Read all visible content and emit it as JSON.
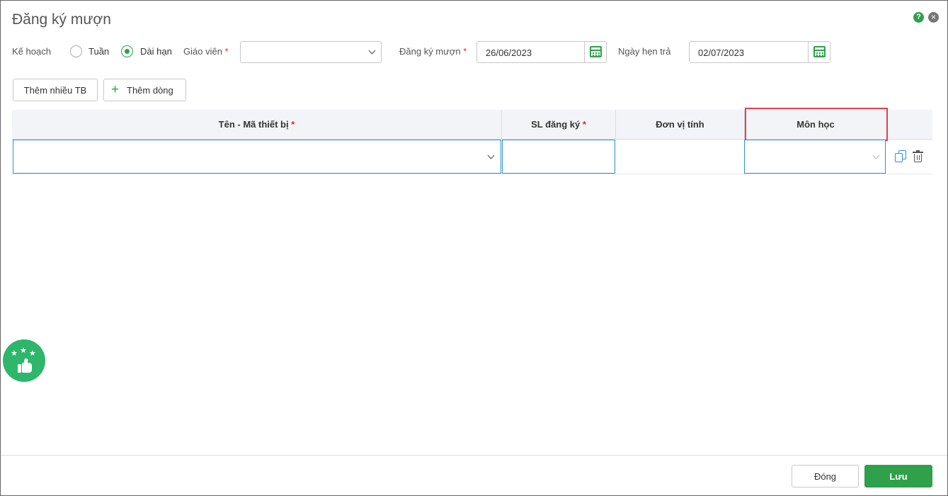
{
  "dialog": {
    "title": "Đăng ký mượn"
  },
  "form": {
    "plan_label": "Kế hoạch",
    "radio_week": "Tuần",
    "radio_long": "Dài hạn",
    "selected_plan": "Dài hạn",
    "teacher_label": "Giáo viên",
    "teacher_value": "",
    "borrow_date_label": "Đăng ký mượn",
    "borrow_date": "26/06/2023",
    "return_date_label": "Ngày hẹn trả",
    "return_date": "02/07/2023",
    "required_mark": "*"
  },
  "toolbar": {
    "add_many_label": "Thêm nhiều TB",
    "add_row_label": "Thêm dòng"
  },
  "grid": {
    "columns": [
      {
        "label": "Tên - Mã thiết bị",
        "required": true
      },
      {
        "label": "SL đăng ký",
        "required": true
      },
      {
        "label": "Đơn vị tính",
        "required": false
      },
      {
        "label": "Môn học",
        "required": false
      }
    ],
    "rows": [
      {
        "device": "",
        "quantity": "",
        "unit": "",
        "subject": ""
      }
    ]
  },
  "footer": {
    "close_label": "Đóng",
    "save_label": "Lưu"
  },
  "colors": {
    "accent": "#2ea14a",
    "required": "#e0282e",
    "focus_border": "#2f8fd0",
    "highlight": "#e2414b",
    "feedback": "#2eb66b"
  },
  "icons": [
    "help-icon",
    "close-icon",
    "chevron-down-icon",
    "calendar-icon",
    "plus-icon",
    "copy-icon",
    "trash-icon",
    "thumbs-up-icon",
    "star-icon"
  ]
}
